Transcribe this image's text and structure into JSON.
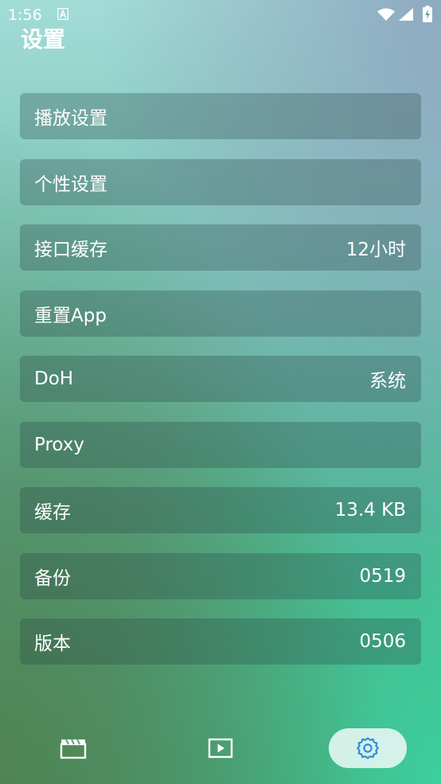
{
  "status_bar": {
    "time": "1:56",
    "icons": [
      "notification-a-icon",
      "wifi-icon",
      "signal-icon",
      "battery-charging-icon"
    ]
  },
  "page": {
    "title": "设置"
  },
  "settings": [
    {
      "label": "播放设置",
      "value": ""
    },
    {
      "label": "个性设置",
      "value": ""
    },
    {
      "label": "接口缓存",
      "value": "12小时"
    },
    {
      "label": "重置App",
      "value": ""
    },
    {
      "label": "DoH",
      "value": "系统"
    },
    {
      "label": "Proxy",
      "value": ""
    },
    {
      "label": "缓存",
      "value": "13.4 KB"
    },
    {
      "label": "备份",
      "value": "0519"
    },
    {
      "label": "版本",
      "value": "0506"
    }
  ],
  "bottom_nav": {
    "items": [
      {
        "icon": "movie-clapper-icon",
        "active": false
      },
      {
        "icon": "play-screen-icon",
        "active": false
      },
      {
        "icon": "gear-icon",
        "active": true
      }
    ],
    "active_color": "#2e8fd6"
  }
}
